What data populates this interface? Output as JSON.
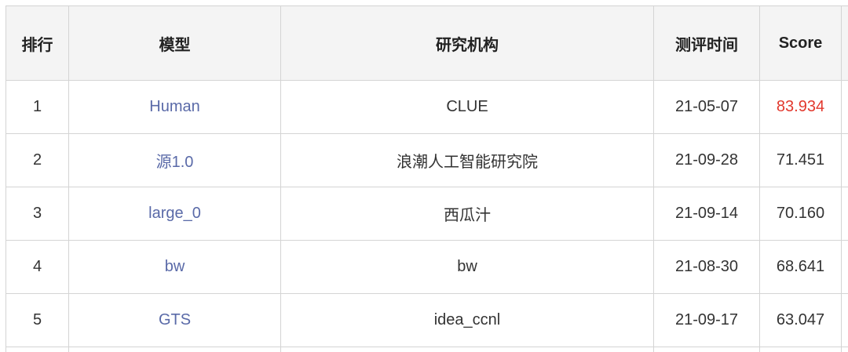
{
  "table": {
    "headers": {
      "rank": "排行",
      "model": "模型",
      "org": "研究机构",
      "date": "测评时间",
      "score": "Score"
    },
    "rows": [
      {
        "rank": "1",
        "model": "Human",
        "org": "CLUE",
        "date": "21-05-07",
        "score": "83.934"
      },
      {
        "rank": "2",
        "model": "源1.0",
        "org": "浪潮人工智能研究院",
        "date": "21-09-28",
        "score": "71.451"
      },
      {
        "rank": "3",
        "model": "large_0",
        "org": "西瓜汁",
        "date": "21-09-14",
        "score": "70.160"
      },
      {
        "rank": "4",
        "model": "bw",
        "org": "bw",
        "date": "21-08-30",
        "score": "68.641"
      },
      {
        "rank": "5",
        "model": "GTS",
        "org": "idea_ccnl",
        "date": "21-09-17",
        "score": "63.047"
      }
    ]
  },
  "colors": {
    "model_link": "#5a6aa8",
    "top_score": "#e2382d",
    "header_bg": "#f4f4f4",
    "border": "#d4d4d4"
  }
}
